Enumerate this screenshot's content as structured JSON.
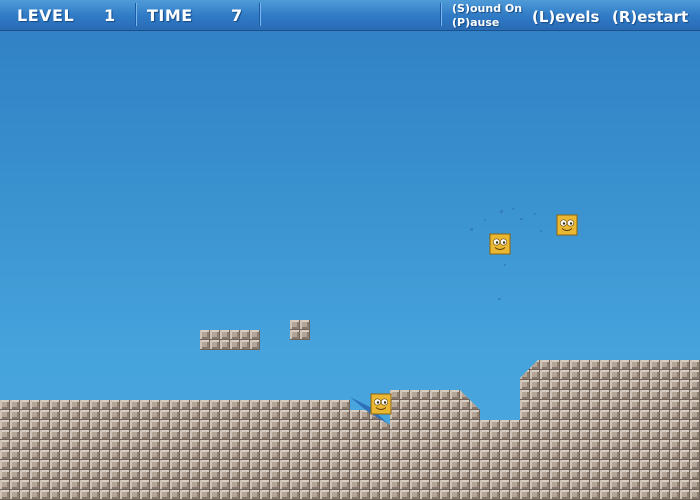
{
  "hud": {
    "level_label": "LEVEL",
    "level_value": "1",
    "time_label": "TIME",
    "time_value": "7",
    "sound_label": "(S)ound On",
    "pause_label": "(P)ause",
    "levels_label": "(L)evels",
    "restart_label": "(R)estart"
  },
  "colors": {
    "sky_top": "#2f7fc4",
    "sky_bottom": "#4aa8df",
    "hud_bar": "#2f79c5",
    "tile_face": "#b3a396",
    "tile_shadow": "#6b5d52",
    "character": "#e9b732"
  },
  "scene": {
    "characters": [
      "smiley-block",
      "smiley-block",
      "smiley-block"
    ],
    "terrain": "stone-tile-ground"
  }
}
